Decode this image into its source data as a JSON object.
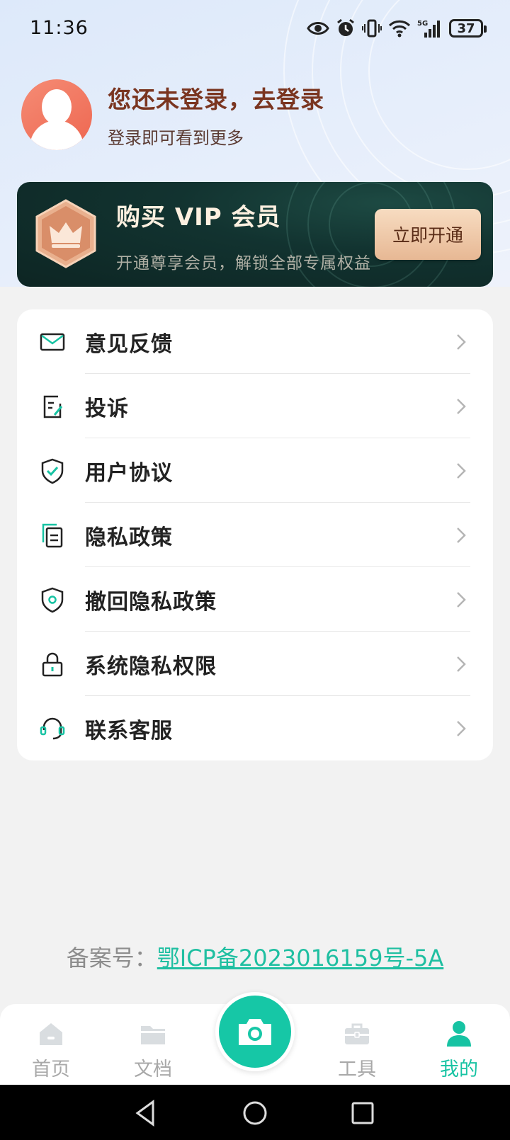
{
  "status_bar": {
    "time": "11:36",
    "battery": "37",
    "network": "5G"
  },
  "profile": {
    "title": "您还未登录，去登录",
    "subtitle": "登录即可看到更多"
  },
  "vip": {
    "title": "购买 VIP 会员",
    "subtitle": "开通尊享会员，解锁全部专属权益",
    "button": "立即开通"
  },
  "menu": {
    "items": [
      {
        "label": "意见反馈",
        "icon": "mail-icon"
      },
      {
        "label": "投诉",
        "icon": "complaint-icon"
      },
      {
        "label": "用户协议",
        "icon": "shield-check-icon"
      },
      {
        "label": "隐私政策",
        "icon": "document-icon"
      },
      {
        "label": "撤回隐私政策",
        "icon": "shield-revoke-icon"
      },
      {
        "label": "系统隐私权限",
        "icon": "lock-icon"
      },
      {
        "label": "联系客服",
        "icon": "headset-icon"
      }
    ]
  },
  "footer": {
    "icp_prefix": "备案号：",
    "icp_link": "鄂ICP备2023016159号-5A"
  },
  "tabbar": {
    "tabs": [
      {
        "label": "首页",
        "icon": "home-icon"
      },
      {
        "label": "文档",
        "icon": "folder-icon"
      },
      {
        "label": "工具",
        "icon": "toolbox-icon"
      },
      {
        "label": "我的",
        "icon": "user-icon"
      }
    ],
    "active": "我的",
    "center": "camera-icon"
  },
  "colors": {
    "accent": "#16c7a6",
    "title_brown": "#7a3520",
    "vip_bg": "#123330",
    "vip_btn": "#e7b894"
  }
}
